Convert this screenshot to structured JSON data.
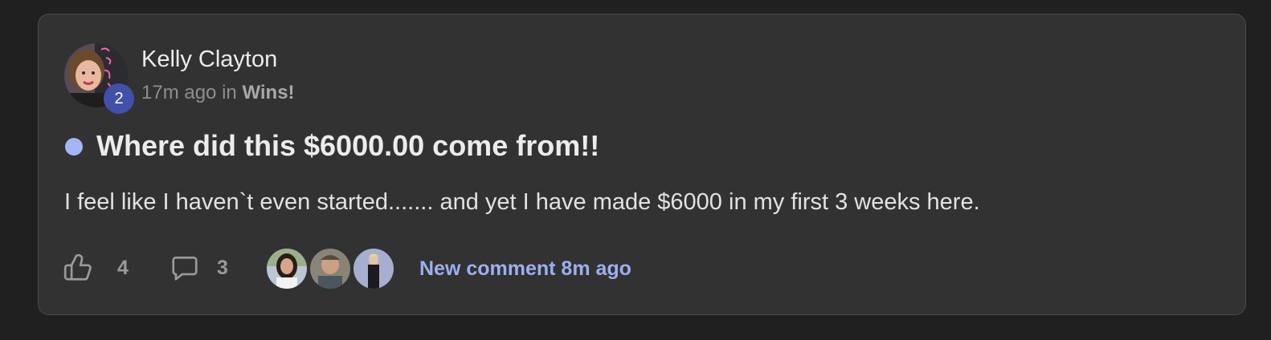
{
  "post": {
    "author": {
      "name": "Kelly Clayton",
      "level": "2"
    },
    "meta": {
      "time": "17m ago",
      "in_word": "in",
      "category": "Wins!"
    },
    "title": "Where did this $6000.00 come from!!",
    "body": "I feel like I haven`t even started....... and yet I have made $6000 in my first 3 weeks here.",
    "likes": "4",
    "comments": "3",
    "last_comment": "New comment 8m ago"
  },
  "icons": {
    "like": "thumbs-up-icon",
    "comment": "speech-bubble-icon"
  },
  "colors": {
    "background": "#202020",
    "card": "#323232",
    "accent_link": "#9bb0f0",
    "unread_dot": "#a4b6f4",
    "level_badge": "#4150a8"
  }
}
